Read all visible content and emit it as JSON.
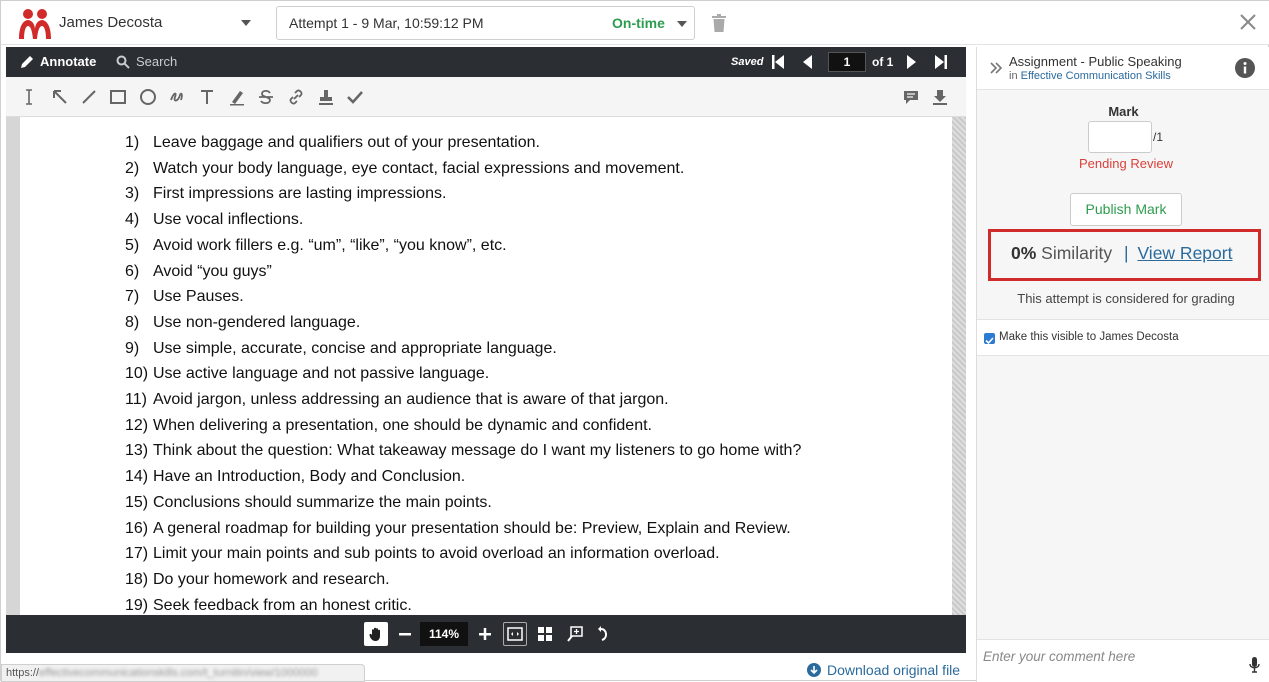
{
  "topbar": {
    "student_name": "James Decosta",
    "attempt_label": "Attempt 1 - 9 Mar, 10:59:12 PM",
    "attempt_status": "On-time",
    "status_color": "#2e9c4f",
    "brand_color": "#d12a2a"
  },
  "viewer": {
    "annotate_label": "Annotate",
    "search_label": "Search",
    "saved_label": "Saved",
    "current_page": "1",
    "page_total_label": "of 1",
    "zoom_level": "114%",
    "tools": [
      "text-cursor-icon",
      "arrow-icon",
      "line-icon",
      "rectangle-icon",
      "ellipse-icon",
      "freehand-icon",
      "text-icon",
      "highlighter-icon",
      "strikethrough-icon",
      "link-icon",
      "stamp-icon",
      "checkmark-icon"
    ],
    "right_tools": [
      "comment-icon",
      "download-icon"
    ]
  },
  "document": {
    "items": [
      {
        "num": "1)",
        "text": "Leave baggage and qualifiers out of your presentation."
      },
      {
        "num": "2)",
        "text": "Watch your body language, eye contact, facial expressions and movement."
      },
      {
        "num": "3)",
        "text": "First impressions are lasting impressions."
      },
      {
        "num": "4)",
        "text": "Use vocal inflections."
      },
      {
        "num": "5)",
        "text": "Avoid work fillers e.g. “um”, “like”, “you know”, etc."
      },
      {
        "num": "6)",
        "text": "Avoid “you guys”"
      },
      {
        "num": "7)",
        "text": "Use Pauses."
      },
      {
        "num": "8)",
        "text": "Use non-gendered language."
      },
      {
        "num": "9)",
        "text": "Use simple, accurate, concise and appropriate language."
      },
      {
        "num": "10)",
        "text": "Use active language and not passive language."
      },
      {
        "num": "11)",
        "text": "Avoid jargon, unless addressing an audience that is aware of that jargon."
      },
      {
        "num": "12)",
        "text": "When delivering a presentation, one should be dynamic and confident."
      },
      {
        "num": "13)",
        "text": "Think about the question: What takeaway message do I want my listeners to go home with?"
      },
      {
        "num": "14)",
        "text": "Have an Introduction, Body and Conclusion."
      },
      {
        "num": "15)",
        "text": "Conclusions should summarize the main points."
      },
      {
        "num": "16)",
        "text": "A general roadmap for building your presentation should be: Preview, Explain and Review."
      },
      {
        "num": "17)",
        "text": "Limit your main points and sub points to avoid overload an information overload."
      },
      {
        "num": "18)",
        "text": "Do your homework and research."
      },
      {
        "num": "19)",
        "text": "Seek feedback from an honest critic."
      }
    ]
  },
  "footer": {
    "status_url_prefix": "https://",
    "status_url_blurred": "effectivecommunicationskills.com/t_turnitin/view/1000000",
    "download_label": "Download original file"
  },
  "side": {
    "assignment_title": "Assignment - Public Speaking",
    "in_label": "in",
    "course_name": "Effective Communication Skills",
    "mark_label": "Mark",
    "mark_value": "",
    "mark_out_of": "/1",
    "pending_label": "Pending Review",
    "publish_label": "Publish Mark",
    "similarity_percent": "0%",
    "similarity_label": "Similarity",
    "similarity_sep": "|",
    "view_report_label": "View Report",
    "grading_note": "This attempt is considered for grading",
    "visible_label": "Make this visible to James Decosta",
    "visible_checked": true,
    "comment_placeholder": "Enter your comment here"
  }
}
